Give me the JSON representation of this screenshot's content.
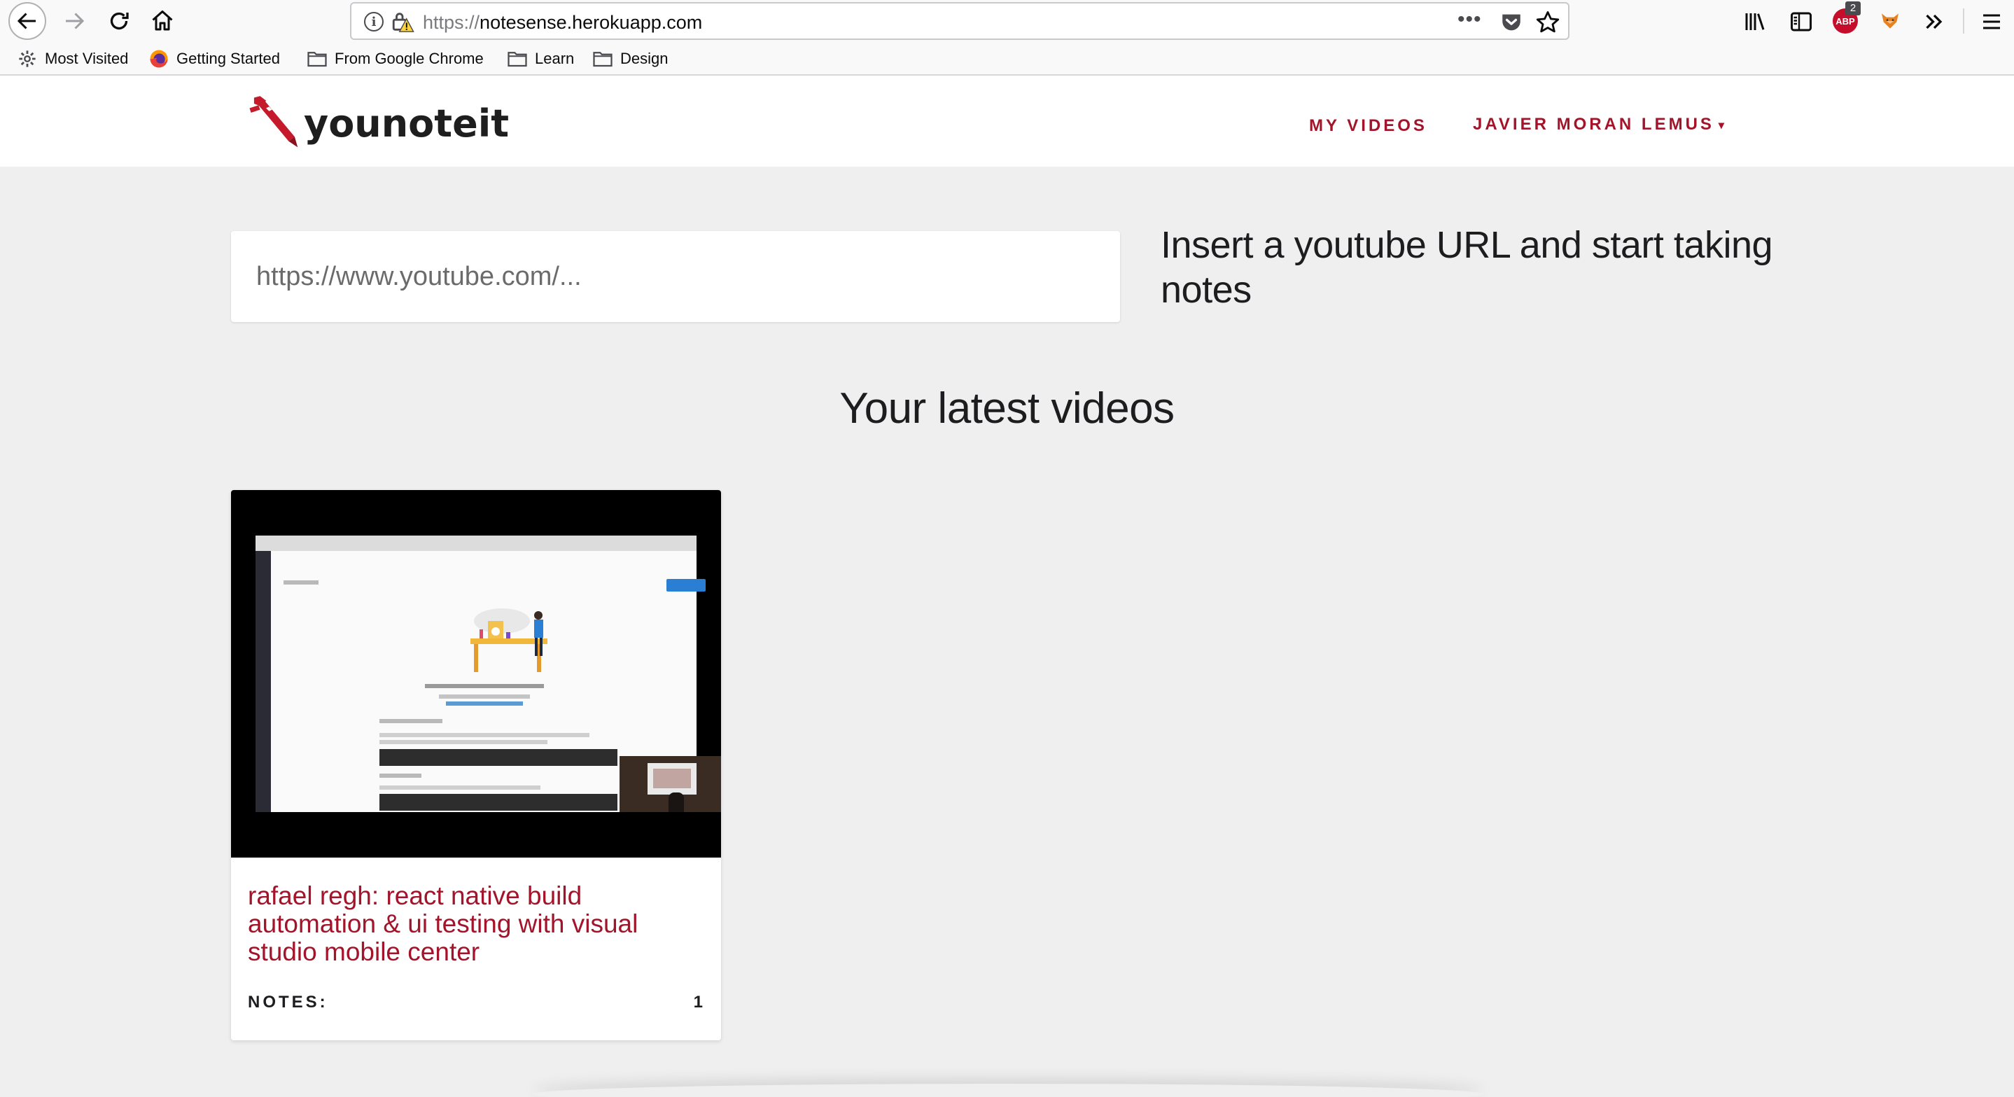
{
  "browser": {
    "url_scheme": "https://",
    "url_host": "notesense.herokuapp.com",
    "url_more": "•••",
    "adblock_label": "ABP",
    "adblock_badge": "2",
    "bookmarks": [
      {
        "label": "Most Visited",
        "icon": "gear-icon"
      },
      {
        "label": "Getting Started",
        "icon": "firefox-icon"
      },
      {
        "label": "From Google Chrome",
        "icon": "folder-icon"
      },
      {
        "label": "Learn",
        "icon": "folder-icon"
      },
      {
        "label": "Design",
        "icon": "folder-icon"
      }
    ]
  },
  "site": {
    "logo_text": "younoteit",
    "nav": {
      "my_videos": "MY VIDEOS",
      "user": "JAVIER MORAN LEMUS",
      "user_caret": "▾"
    }
  },
  "main": {
    "url_input": {
      "placeholder": "https://www.youtube.com/...",
      "value": ""
    },
    "hint": "Insert a youtube URL and start taking notes",
    "section_title": "Your latest videos",
    "videos": [
      {
        "title": "rafael regh: react native build automation & ui testing with visual studio mobile center",
        "notes_label": "NOTES:",
        "notes_count": "1"
      }
    ]
  },
  "colors": {
    "accent": "#a3142a",
    "background": "#efefef",
    "text": "#1d1d1f"
  }
}
